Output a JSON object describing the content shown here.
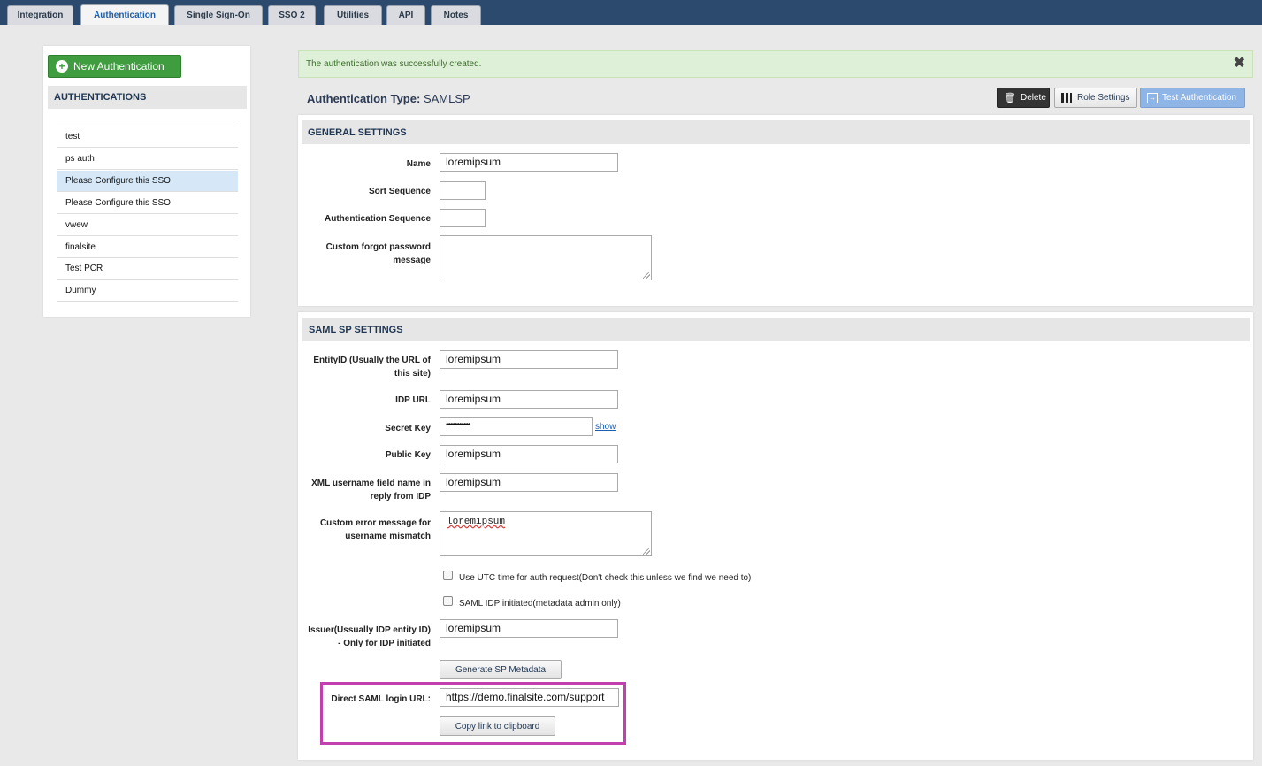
{
  "tabs": [
    {
      "label": "Integration",
      "active": false
    },
    {
      "label": "Authentication",
      "active": true
    },
    {
      "label": "Single Sign-On",
      "active": false
    },
    {
      "label": "SSO 2",
      "active": false
    },
    {
      "label": "Utilities",
      "active": false
    },
    {
      "label": "API",
      "active": false
    },
    {
      "label": "Notes",
      "active": false
    }
  ],
  "sidebar": {
    "new_button_label": "New Authentication",
    "heading": "AUTHENTICATIONS",
    "items": [
      "test",
      "ps auth",
      "Please Configure this SSO",
      "Please Configure this SSO",
      "vwew",
      "finalsite",
      "Test PCR",
      "Dummy"
    ],
    "selected_index": 2
  },
  "alert": {
    "message": "The authentication was successfully created."
  },
  "auth_type": {
    "label": "Authentication Type:",
    "value": "SAMLSP"
  },
  "toolbar": {
    "delete_label": "Delete",
    "role_settings_label": "Role Settings",
    "test_auth_label": "Test Authentication"
  },
  "general": {
    "heading": "GENERAL SETTINGS",
    "name_label": "Name",
    "name_value": "loremipsum",
    "sort_label": "Sort Sequence",
    "sort_value": "",
    "auth_seq_label": "Authentication Sequence",
    "auth_seq_value": "",
    "forgot_label": "Custom forgot password message",
    "forgot_value": ""
  },
  "saml": {
    "heading": "SAML SP SETTINGS",
    "entity_label": "EntityID (Usually the URL of this site)",
    "entity_value": "loremipsum",
    "idp_label": "IDP URL",
    "idp_value": "loremipsum",
    "secret_label": "Secret Key",
    "secret_value": "•••••••••••",
    "show_label": "show",
    "public_label": "Public Key",
    "public_value": "loremipsum",
    "xml_label": "XML username field name in reply from IDP",
    "xml_value": "loremipsum",
    "error_label": "Custom error message for username mismatch",
    "error_value": "loremipsum",
    "utc_label": "Use UTC time for auth request(Don't check this unless we find we need to)",
    "idp_init_label": "SAML IDP initiated(metadata admin only)",
    "issuer_label": "Issuer(Ussually IDP entity ID) - Only for IDP initiated",
    "issuer_value": "loremipsum",
    "generate_label": "Generate SP Metadata",
    "direct_label": "Direct SAML login URL:",
    "direct_value": "https://demo.finalsite.com/support",
    "copy_label": "Copy link to clipboard"
  }
}
